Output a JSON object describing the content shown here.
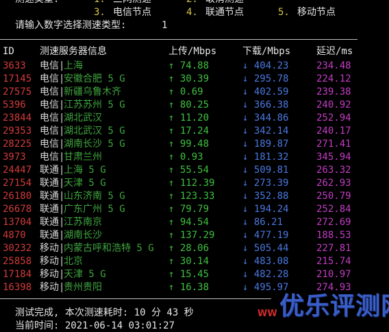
{
  "menu": {
    "line1_label": "测速类型:",
    "opt1_num": "1.",
    "opt1_text": "三网测速",
    "opt2_num": "2.",
    "opt2_text": "取消测速",
    "opt3_num": "3.",
    "opt3_text": "电信节点",
    "opt4_num": "4.",
    "opt4_text": "联通节点",
    "opt5_num": "5.",
    "opt5_text": "移动节点"
  },
  "prompt": {
    "text": "请输入数字选择测速类型: ",
    "value": "1"
  },
  "table": {
    "headers": {
      "id": "ID",
      "server": "测速服务器信息",
      "upload": "上传/Mbps",
      "download": "下载/Mbps",
      "latency": "延迟/ms"
    },
    "rows": [
      {
        "id": "3633",
        "isp": "电信",
        "node": "上海",
        "up": "↑ 74.88",
        "down": "↓ 404.23",
        "lat": "234.48"
      },
      {
        "id": "17145",
        "isp": "电信",
        "node": "安徽合肥 5 G",
        "up": "↑ 30.39",
        "down": "↓ 295.78",
        "lat": "224.12"
      },
      {
        "id": "27575",
        "isp": "电信",
        "node": "新疆乌鲁木齐",
        "up": "↑ 0.69",
        "down": "↓ 402.59",
        "lat": "239.38"
      },
      {
        "id": "5396",
        "isp": "电信",
        "node": "江苏苏州 5 G",
        "up": "↑ 80.25",
        "down": "↓ 366.38",
        "lat": "240.92"
      },
      {
        "id": "23844",
        "isp": "电信",
        "node": "湖北武汉",
        "up": "↑ 11.20",
        "down": "↓ 344.86",
        "lat": "252.94"
      },
      {
        "id": "29353",
        "isp": "电信",
        "node": "湖北武汉 5 G",
        "up": "↑ 17.24",
        "down": "↓ 342.14",
        "lat": "240.17"
      },
      {
        "id": "28225",
        "isp": "电信",
        "node": "湖南长沙 5 G",
        "up": "↑ 99.48",
        "down": "↓ 189.87",
        "lat": "271.41"
      },
      {
        "id": "3973",
        "isp": "电信",
        "node": "甘肃兰州",
        "up": "↑ 0.93",
        "down": "↓ 181.32",
        "lat": "345.94"
      },
      {
        "id": "24447",
        "isp": "联通",
        "node": "上海 5 G",
        "up": "↑ 55.54",
        "down": "↓ 509.81",
        "lat": "263.32"
      },
      {
        "id": "27154",
        "isp": "联通",
        "node": "天津 5 G",
        "up": "↑ 112.39",
        "down": "↓ 273.39",
        "lat": "262.93"
      },
      {
        "id": "26180",
        "isp": "联通",
        "node": "山东济南 5 G",
        "up": "↑ 123.33",
        "down": "↓ 352.88",
        "lat": "250.79"
      },
      {
        "id": "26678",
        "isp": "联通",
        "node": "广东广州 5 G",
        "up": "↑ 79.79",
        "down": "↓ 194.24",
        "lat": "252.84"
      },
      {
        "id": "13704",
        "isp": "联通",
        "node": "江苏南京",
        "up": "↑ 94.54",
        "down": "↓ 86.21",
        "lat": "272.69"
      },
      {
        "id": "4870",
        "isp": "联通",
        "node": "湖南长沙",
        "up": "↑ 137.29",
        "down": "↓ 477.19",
        "lat": "188.53"
      },
      {
        "id": "30232",
        "isp": "移动",
        "node": "内蒙古呼和浩特 5 G",
        "up": "↑ 28.06",
        "down": "↓ 505.44",
        "lat": "227.81"
      },
      {
        "id": "25858",
        "isp": "移动",
        "node": "北京",
        "up": "↑ 30.14",
        "down": "↓ 483.08",
        "lat": "215.74"
      },
      {
        "id": "17184",
        "isp": "移动",
        "node": "天津 5 G",
        "up": "↑ 15.45",
        "down": "↓ 482.28",
        "lat": "210.97"
      },
      {
        "id": "16398",
        "isp": "移动",
        "node": "贵州贵阳",
        "up": "↑ 16.38",
        "down": "↓ 495.97",
        "lat": "274.93"
      }
    ]
  },
  "footer": {
    "done_text": "测试完成, 本次测速耗时: 10 分 43 秒",
    "time_text": "当前时间: 2021-06-14 03:01:27"
  },
  "watermark": {
    "text": "优乐评测网",
    "prefix": "WW"
  },
  "colors": {
    "background": "#000000",
    "id": "#d23b3b",
    "node": "#3fa53f",
    "upload": "#3fc03f",
    "download": "#4a79e0",
    "latency": "#c43cc4",
    "menu_number": "#d9c74a"
  }
}
